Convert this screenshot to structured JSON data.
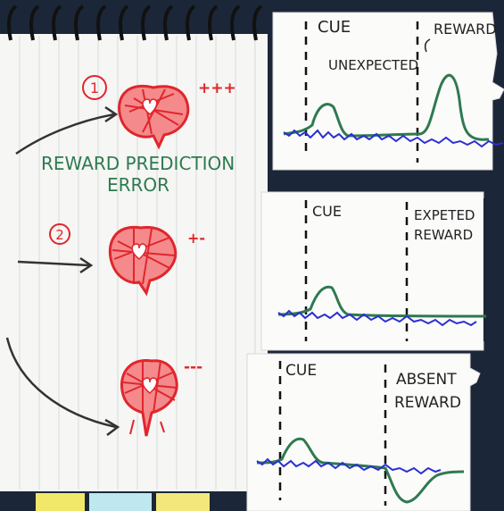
{
  "notebook": {
    "items": [
      {
        "number": "1",
        "signs": "+++"
      },
      {
        "number": "2",
        "signs": "+-"
      },
      {
        "number": "",
        "signs": "---"
      }
    ],
    "rpe_label_line1": "REWARD PREDICTION",
    "rpe_label_line2": "ERROR"
  },
  "cards": [
    {
      "cue": "CUE",
      "reward_line1": "REWARD",
      "reward_line2": "",
      "note": "UNEXPECTED"
    },
    {
      "cue": "CUE",
      "reward_line1": "EXPETED",
      "reward_line2": "REWARD",
      "note": ""
    },
    {
      "cue": "CUE",
      "reward_line1": "ABSENT",
      "reward_line2": "REWARD",
      "note": ""
    }
  ],
  "colors": {
    "ink_green": "#2e7a4f",
    "ink_red": "#e0262c",
    "ink_blue": "#2a2fd0",
    "ink_black": "#222222",
    "paper": "#f7f7f5",
    "card": "#fbfbfa",
    "background": "#1d2a3c"
  }
}
